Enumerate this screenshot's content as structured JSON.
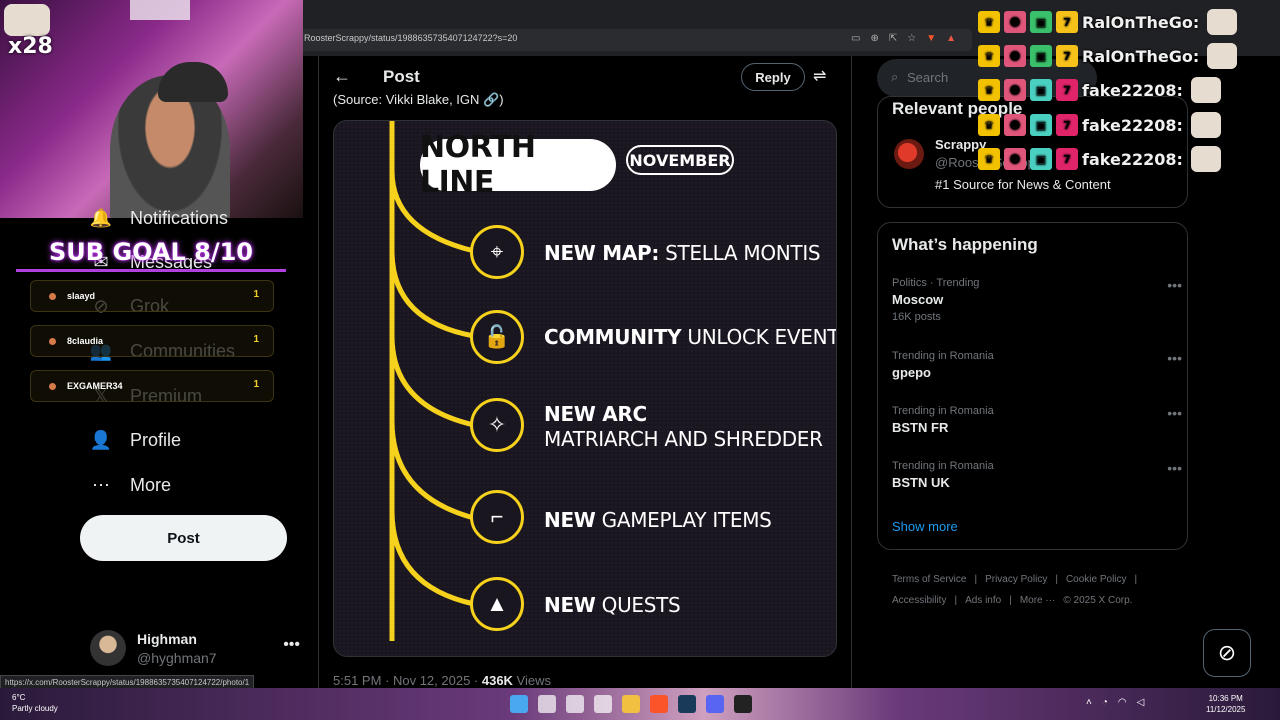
{
  "browser": {
    "url": "RoosterScrappy/status/1988635735407124722?s=20",
    "status_url": "https://x.com/RoosterScrappy/status/1988635735407124722/photo/1"
  },
  "stream": {
    "gift_count": "x28",
    "sub_goal": "SUB GOAL 8/10",
    "subs": [
      {
        "name": "slaayd",
        "count": "1"
      },
      {
        "name": "8claudia",
        "count": "1"
      },
      {
        "name": "EXGAMER34",
        "count": "1"
      }
    ],
    "chat": [
      {
        "user": "RalOnTheGo:"
      },
      {
        "user": "RalOnTheGo:"
      },
      {
        "user": "fake22208:"
      },
      {
        "user": "fake22208:"
      },
      {
        "user": "fake22208:"
      }
    ]
  },
  "nav": {
    "items": [
      {
        "label": "Notifications",
        "icon": "bell-icon"
      },
      {
        "label": "Messages",
        "icon": "mail-icon"
      },
      {
        "label": "Grok",
        "icon": "grok-icon"
      },
      {
        "label": "Communities",
        "icon": "communities-icon"
      },
      {
        "label": "Premium",
        "icon": "x-logo-icon"
      },
      {
        "label": "Profile",
        "icon": "person-icon"
      },
      {
        "label": "More",
        "icon": "more-circle-icon"
      }
    ],
    "post_button": "Post",
    "account": {
      "name": "Highman",
      "handle": "@hyghman7"
    }
  },
  "main": {
    "title": "Post",
    "reply_label": "Reply",
    "source_line": "(Source: Vikki Blake, IGN 🔗)",
    "timestamp": "5:51 PM · Nov 12, 2025 · ",
    "views_count": "436K",
    "views_label": " Views",
    "roadmap": {
      "title": "NORTH LINE",
      "month": "NOVEMBER",
      "items": [
        {
          "bold": "NEW MAP:",
          "light": "STELLA MONTIS",
          "icon": "map-pin-icon"
        },
        {
          "bold": "COMMUNITY",
          "light": "UNLOCK EVENT",
          "icon": "unlock-icon"
        },
        {
          "bold": "NEW ARC",
          "light": "MATRIARCH AND SHREDDER",
          "icon": "arc-icon"
        },
        {
          "bold": "NEW",
          "light": "GAMEPLAY ITEMS",
          "icon": "gun-icon"
        },
        {
          "bold": "NEW",
          "light": "QUESTS",
          "icon": "arrow-up-icon"
        }
      ]
    }
  },
  "right": {
    "search_placeholder": "Search",
    "relevant_title": "Relevant people",
    "relevant_person": {
      "name": "Scrappy",
      "handle": "@RoosterScrappy",
      "bio": "#1 Source for News & Content"
    },
    "happening_title": "What’s happening",
    "trends": [
      {
        "category": "Politics · Trending",
        "name": "Moscow",
        "posts": "16K posts"
      },
      {
        "category": "Trending in Romania",
        "name": "gpepo",
        "posts": ""
      },
      {
        "category": "Trending in Romania",
        "name": "BSTN FR",
        "posts": ""
      },
      {
        "category": "Trending in Romania",
        "name": "BSTN UK",
        "posts": ""
      }
    ],
    "show_more": "Show more",
    "footer": [
      "Terms of Service",
      "|",
      "Privacy Policy",
      "|",
      "Cookie Policy",
      "|",
      "Accessibility",
      "|",
      "Ads info",
      "|",
      "More ···",
      "© 2025 X Corp."
    ]
  },
  "taskbar": {
    "temp": "6°C",
    "weather": "Partly cloudy",
    "time": "10:36 PM",
    "date": "11/12/2025"
  }
}
